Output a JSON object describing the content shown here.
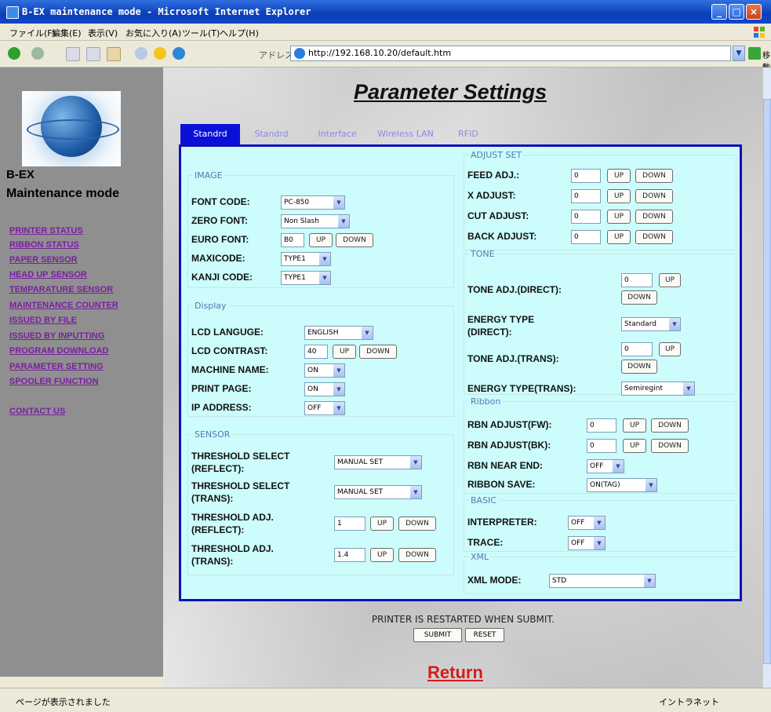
{
  "window": {
    "title": "B-EX maintenance mode - Microsoft Internet Explorer"
  },
  "menubar": [
    "ファイル(F)",
    "編集(E)",
    "表示(V)",
    "お気に入り(A)",
    "ツール(T)",
    "ヘルプ(H)"
  ],
  "address": {
    "label": "アドレス(D)",
    "url": "http://192.168.10.20/default.htm",
    "go_label": "移動"
  },
  "sidebar": {
    "brand_line1": "B-EX",
    "brand_line2": "Maintenance mode",
    "links": [
      "PRINTER STATUS",
      "RIBBON STATUS",
      "PAPER SENSOR",
      "HEAD UP SENSOR",
      "TEMPARATURE SENSOR",
      "MAINTENANCE COUNTER",
      "ISSUED BY FILE",
      "ISSUED BY INPUTTING",
      "PROGRAM DOWNLOAD",
      "PARAMETER SETTING",
      "SPOOLER FUNCTION"
    ],
    "contact": "CONTACT US"
  },
  "page": {
    "title": "Parameter Settings"
  },
  "tabs": [
    "Standrd",
    "Standrd",
    "Interface",
    "Wireless LAN",
    "RFID"
  ],
  "image": {
    "legend": "IMAGE",
    "font_code": {
      "label": "FONT CODE:",
      "value": "PC-850"
    },
    "zero_font": {
      "label": "ZERO FONT:",
      "value": "Non Slash"
    },
    "euro_font": {
      "label": "EURO FONT:",
      "value": "B0"
    },
    "maxicode": {
      "label": "MAXICODE:",
      "value": "TYPE1"
    },
    "kanji_code": {
      "label": "KANJI CODE:",
      "value": "TYPE1"
    }
  },
  "display": {
    "legend": "Display",
    "lcd_language": {
      "label": "LCD LANGUGE:",
      "value": "ENGLISH"
    },
    "lcd_contrast": {
      "label": "LCD CONTRAST:",
      "value": "40"
    },
    "machine_name": {
      "label": "MACHINE NAME:",
      "value": "ON"
    },
    "print_page": {
      "label": "PRINT PAGE:",
      "value": "ON"
    },
    "ip_address": {
      "label": "IP ADDRESS:",
      "value": "OFF"
    }
  },
  "sensor": {
    "legend": "SENSOR",
    "thr_sel_reflect": {
      "label1": "THRESHOLD SELECT",
      "label2": "(REFLECT):",
      "value": "MANUAL SET"
    },
    "thr_sel_trans": {
      "label1": "THRESHOLD SELECT",
      "label2": "(TRANS):",
      "value": "MANUAL SET"
    },
    "thr_adj_reflect": {
      "label1": "THRESHOLD ADJ.",
      "label2": "(REFLECT):",
      "value": "1"
    },
    "thr_adj_trans": {
      "label1": "THRESHOLD ADJ.",
      "label2": "(TRANS):",
      "value": "1.4"
    }
  },
  "adjust": {
    "legend": "ADJUST SET",
    "feed": {
      "label": "FEED ADJ.:",
      "value": "0"
    },
    "x": {
      "label": "X ADJUST:",
      "value": "0"
    },
    "cut": {
      "label": "CUT ADJUST:",
      "value": "0"
    },
    "back": {
      "label": "BACK ADJUST:",
      "value": "0"
    }
  },
  "tone": {
    "legend": "TONE",
    "tone_direct": {
      "label": "TONE ADJ.(DIRECT):",
      "value": "0"
    },
    "energy_direct": {
      "label1": "ENERGY TYPE",
      "label2": "(DIRECT):",
      "value": "Standard"
    },
    "tone_trans": {
      "label": "TONE ADJ.(TRANS):",
      "value": "0"
    },
    "energy_trans": {
      "label": "ENERGY TYPE(TRANS):",
      "value": "Semiregint"
    }
  },
  "ribbon": {
    "legend": "Ribbon",
    "adj_fw": {
      "label": "RBN ADJUST(FW):",
      "value": "0"
    },
    "adj_bk": {
      "label": "RBN ADJUST(BK):",
      "value": "0"
    },
    "near_end": {
      "label": "RBN NEAR END:",
      "value": "OFF"
    },
    "save": {
      "label": "RIBBON SAVE:",
      "value": "ON(TAG)"
    }
  },
  "basic": {
    "legend": "BASIC",
    "interpreter": {
      "label": "INTERPRETER:",
      "value": "OFF"
    },
    "trace": {
      "label": "TRACE:",
      "value": "OFF"
    }
  },
  "xml": {
    "legend": "XML",
    "mode": {
      "label": "XML MODE:",
      "value": "STD"
    }
  },
  "buttons": {
    "up": "UP",
    "down": "DOWN",
    "submit": "SUBMIT",
    "reset": "RESET"
  },
  "footer": {
    "note": "PRINTER IS RESTARTED WHEN SUBMIT.",
    "return": "Return"
  },
  "statusbar": {
    "text": "ページが表示されました",
    "zone": "イントラネット"
  }
}
